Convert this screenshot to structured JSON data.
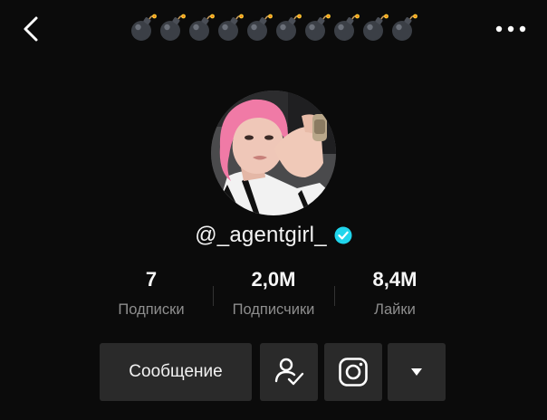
{
  "header": {
    "title_emoji_icon": "bomb-emoji-icon",
    "title_emoji_count": 10,
    "back_icon": "chevron-left-icon",
    "more_icon": "more-horizontal-icon"
  },
  "profile": {
    "username": "@_agentgirl_",
    "verified": true,
    "avatar_icon": "profile-photo"
  },
  "stats": [
    {
      "value": "7",
      "label": "Подписки"
    },
    {
      "value": "2,0M",
      "label": "Подписчики"
    },
    {
      "value": "8,4M",
      "label": "Лайки"
    }
  ],
  "actions": {
    "message_label": "Сообщение",
    "follow_icon": "user-check-icon",
    "instagram_icon": "instagram-icon",
    "dropdown_icon": "caret-down-icon"
  },
  "colors": {
    "background": "#0b0b0b",
    "button_bg": "#2a2a2a",
    "muted_text": "#8e8e8e",
    "verified_blue": "#20d5ec"
  }
}
